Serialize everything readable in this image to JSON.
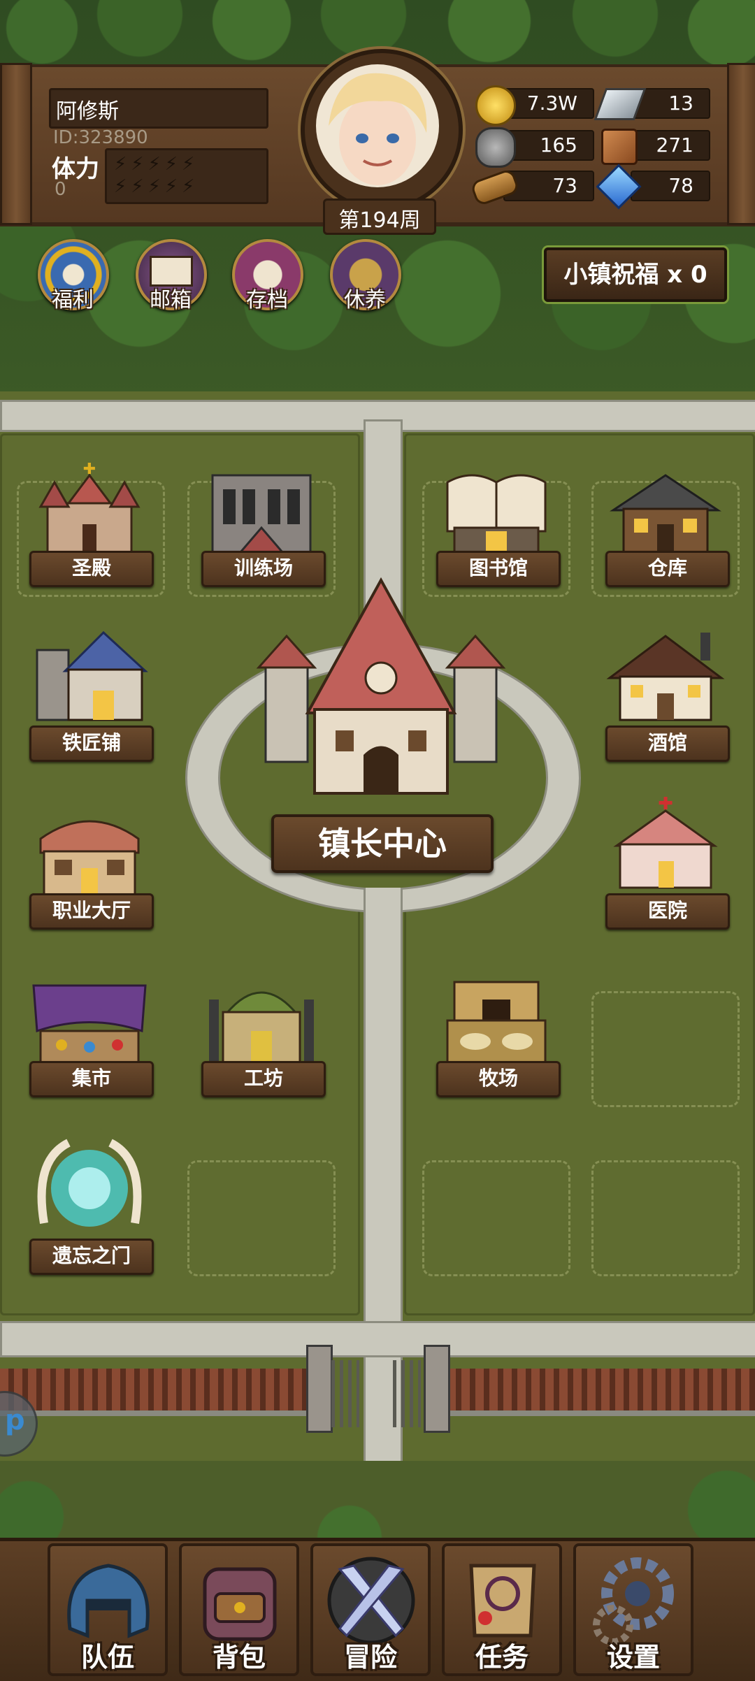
{
  "player": {
    "name": "阿修斯",
    "id_text": "ID:323890",
    "stamina_label": "体力",
    "stamina_value": "0",
    "week": "第194周"
  },
  "resources": [
    {
      "icon": "gold-coin-icon",
      "value": "7.3W",
      "color": "#e0b020"
    },
    {
      "icon": "iron-ingot-icon",
      "value": "13",
      "color": "#c5ccd2"
    },
    {
      "icon": "stone-icon",
      "value": "165",
      "color": "#8c8c8c"
    },
    {
      "icon": "leather-icon",
      "value": "271",
      "color": "#b0693a"
    },
    {
      "icon": "wood-log-icon",
      "value": "73",
      "color": "#b07a3a"
    },
    {
      "icon": "crystal-icon",
      "value": "78",
      "color": "#4aa0e8"
    }
  ],
  "quick_buttons": [
    {
      "icon": "welfare-shield-icon",
      "label": "福利"
    },
    {
      "icon": "mailbox-icon",
      "label": "邮箱"
    },
    {
      "icon": "save-scroll-icon",
      "label": "存档"
    },
    {
      "icon": "rest-scroll-icon",
      "label": "休养"
    }
  ],
  "blessing": {
    "label": "小镇祝福 x 0"
  },
  "center": {
    "label": "镇长中心"
  },
  "buildings": {
    "holy_hall": "圣殿",
    "training": "训练场",
    "library": "图书馆",
    "warehouse": "仓库",
    "blacksmith": "铁匠铺",
    "tavern": "酒馆",
    "job_hall": "职业大厅",
    "hospital": "医院",
    "market": "集市",
    "workshop": "工坊",
    "ranch": "牧场",
    "portal": "遗忘之门"
  },
  "tabs": [
    {
      "icon": "helmet-icon",
      "label": "队伍"
    },
    {
      "icon": "backpack-icon",
      "label": "背包"
    },
    {
      "icon": "crossed-swords-icon",
      "label": "冒险"
    },
    {
      "icon": "quest-scroll-icon",
      "label": "任务"
    },
    {
      "icon": "gear-icon",
      "label": "设置"
    }
  ],
  "side_button": {
    "label": "p"
  },
  "colors": {
    "panel": "#6b4a2d",
    "grass": "#5e6b2f",
    "path": "#c9c8bc",
    "accent_gold": "#b4893f"
  }
}
